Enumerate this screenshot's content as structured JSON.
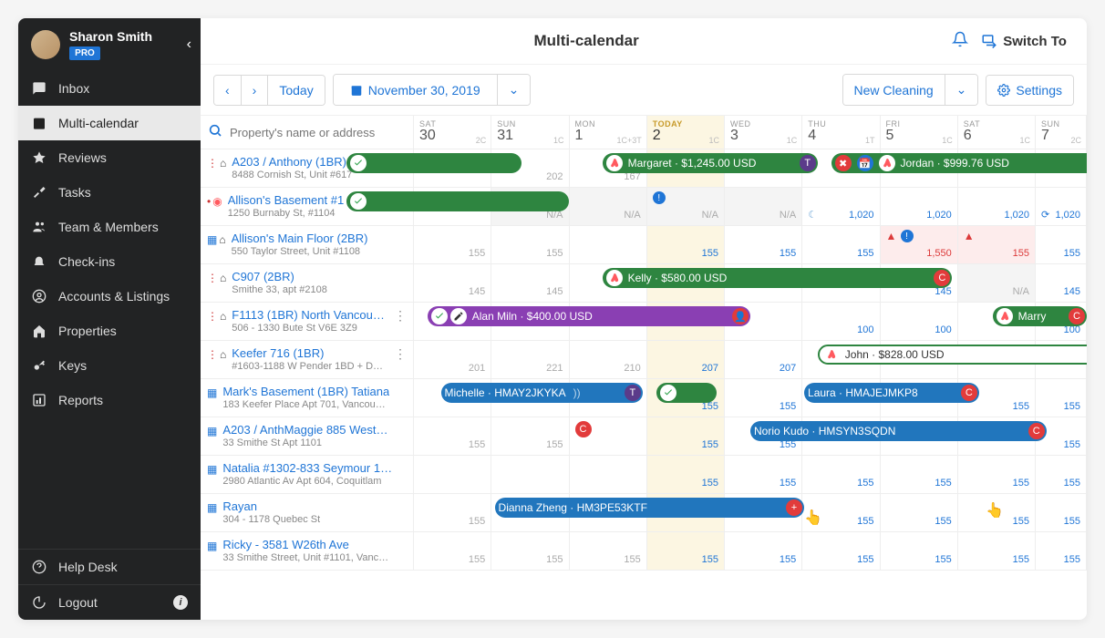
{
  "user": {
    "name": "Sharon Smith",
    "badge": "PRO"
  },
  "nav": {
    "items": [
      {
        "icon": "inbox",
        "label": "Inbox"
      },
      {
        "icon": "calendar",
        "label": "Multi-calendar",
        "active": true
      },
      {
        "icon": "star",
        "label": "Reviews"
      },
      {
        "icon": "broom",
        "label": "Tasks"
      },
      {
        "icon": "team",
        "label": "Team & Members"
      },
      {
        "icon": "bell",
        "label": "Check-ins"
      },
      {
        "icon": "account",
        "label": "Accounts & Listings"
      },
      {
        "icon": "home",
        "label": "Properties"
      },
      {
        "icon": "key",
        "label": "Keys"
      },
      {
        "icon": "chart",
        "label": "Reports"
      }
    ],
    "footer": [
      {
        "icon": "help",
        "label": "Help Desk"
      },
      {
        "icon": "logout",
        "label": "Logout",
        "info": true
      }
    ]
  },
  "header": {
    "title": "Multi-calendar",
    "switch": "Switch To"
  },
  "toolbar": {
    "today": "Today",
    "date": "November 30, 2019",
    "new_cleaning": "New Cleaning",
    "settings": "Settings"
  },
  "search": {
    "placeholder": "Property's name or address"
  },
  "days": [
    {
      "dow": "SAT",
      "num": "30",
      "cc": "2C"
    },
    {
      "dow": "SUN",
      "num": "31",
      "cc": "1C"
    },
    {
      "dow": "MON",
      "num": "1",
      "cc": "1C+3T"
    },
    {
      "dow": "TODAY",
      "num": "2",
      "cc": "1C",
      "today": true
    },
    {
      "dow": "WED",
      "num": "3",
      "cc": "1C"
    },
    {
      "dow": "THU",
      "num": "4",
      "cc": "1T"
    },
    {
      "dow": "FRI",
      "num": "5",
      "cc": "1C"
    },
    {
      "dow": "SAT",
      "num": "6",
      "cc": "1C"
    },
    {
      "dow": "SUN",
      "num": "7",
      "cc": "2C"
    }
  ],
  "properties": [
    {
      "name": "A203 / Anthony (1BR)",
      "addr": "8488 Cornish St, Unit #617",
      "icons": [
        "dots",
        "home"
      ],
      "menu": false,
      "cells": [
        "202",
        "167",
        "",
        "",
        "",
        "",
        "",
        ""
      ],
      "events": [
        {
          "text": "",
          "color": "green",
          "start": -10,
          "end": 16,
          "check": true
        },
        {
          "text": "Margaret · $1,245.00 USD",
          "color": "green",
          "air": true,
          "start": 28,
          "end": 60,
          "rbadge": "pur",
          "rchar": "T"
        },
        {
          "text": "Jordan · $999.76 USD",
          "color": "green",
          "air": true,
          "start": 62,
          "end": 105,
          "lred": true,
          "lblue": true
        }
      ]
    },
    {
      "name": "Allison's Basement #1 (1BR)",
      "addr": "1250 Burnaby St, #1104",
      "icons": [
        "dot-r",
        "air"
      ],
      "cells": [
        "",
        "N/A",
        "N/A",
        "N/A",
        "N/A",
        "1,020",
        "1,020",
        "1,020",
        "1,020"
      ],
      "cellClass": [
        "",
        "na",
        "na",
        "na",
        "na",
        "",
        "",
        "",
        ""
      ],
      "cellStyle": [
        "",
        "",
        "",
        "",
        "",
        "moon b",
        "b",
        "b",
        "refresh b"
      ],
      "events": [
        {
          "text": "",
          "color": "green",
          "start": -10,
          "end": 23,
          "check": true
        }
      ],
      "exclAt": 3
    },
    {
      "name": "Allison's Main Floor (2BR)",
      "addr": "550 Taylor Street, Unit #1108",
      "icons": [
        "blue-sq",
        "home"
      ],
      "cells": [
        "155",
        "155",
        "",
        "155",
        "155",
        "155",
        "1,550",
        "155",
        "155"
      ],
      "cellClass": [
        "",
        "",
        "",
        "",
        "",
        "",
        "pink",
        "pink",
        ""
      ],
      "cellStyle": [
        "",
        "",
        "",
        "b",
        "b",
        "b",
        "warn excl red",
        "warn red",
        "b"
      ]
    },
    {
      "name": "C907 (2BR)",
      "addr": "Smithe 33, apt #2108",
      "icons": [
        "dots",
        "home"
      ],
      "cells": [
        "145",
        "145",
        "",
        "",
        "",
        "",
        "145",
        "N/A",
        "145"
      ],
      "cellClass": [
        "",
        "",
        "",
        "",
        "",
        "",
        "",
        "na",
        ""
      ],
      "cellStyle": [
        "",
        "",
        "",
        "",
        "",
        "",
        "b",
        "",
        "b"
      ],
      "events": [
        {
          "text": "Kelly · $580.00 USD",
          "color": "green",
          "air": true,
          "start": 28,
          "end": 80,
          "rbadge": "red",
          "rchar": "C"
        }
      ]
    },
    {
      "name": "F1113 (1BR) North Vancouver",
      "addr": "506 - 1330 Bute St V6E 3Z9",
      "icons": [
        "dots",
        "home"
      ],
      "menu": true,
      "cells": [
        "",
        "",
        "",
        "",
        "",
        "100",
        "100",
        "",
        "100"
      ],
      "cellStyle": [
        "",
        "",
        "",
        "",
        "",
        "b",
        "b",
        "",
        "b"
      ],
      "events": [
        {
          "text": "Alan Miln · $400.00 USD",
          "color": "purple",
          "start": 2,
          "end": 50,
          "check": true,
          "pencil": true,
          "rbadge": "red",
          "rperson": true
        },
        {
          "text": "Marry",
          "color": "green",
          "air": true,
          "start": 86,
          "end": 100,
          "rbadge": "red",
          "rchar": "C"
        }
      ]
    },
    {
      "name": "Keefer 716 (1BR)",
      "addr": "#1603-1188 W Pender 1BD + D…",
      "icons": [
        "dots",
        "home"
      ],
      "menu": true,
      "cells": [
        "201",
        "221",
        "210",
        "207",
        "207",
        "",
        "",
        "",
        ""
      ],
      "cellStyle": [
        "",
        "",
        "",
        "b",
        "b",
        "",
        "",
        "",
        ""
      ],
      "events": [
        {
          "text": "John · $828.00 USD",
          "color": "green",
          "air": true,
          "whitebg": true,
          "start": 60,
          "end": 105
        }
      ]
    },
    {
      "name": "Mark's Basement (1BR) Tatiana",
      "addr": "183 Keefer Place Apt 701, Vancou…",
      "icons": [
        "blue-sq"
      ],
      "cells": [
        "",
        "",
        "",
        "155",
        "155",
        "",
        "",
        "155",
        "155"
      ],
      "cellStyle": [
        "",
        "",
        "",
        "b",
        "b",
        "",
        "",
        "b",
        "b"
      ],
      "events": [
        {
          "text": "Michelle · HMAY2JKYKA",
          "color": "blue",
          "start": 4,
          "end": 34,
          "rbadge": "pur",
          "rchar": "T",
          "tail": true
        },
        {
          "color": "green",
          "start": 36,
          "end": 45,
          "checkonly": true
        },
        {
          "text": "Laura · HMAJEJMKP8",
          "color": "blue",
          "start": 58,
          "end": 84,
          "rbadge": "red",
          "rchar": "C"
        }
      ]
    },
    {
      "name": "A203 / AnthMaggie 885 West…",
      "addr": "33 Smithe St Apt 1101",
      "icons": [
        "blue-sq"
      ],
      "cells": [
        "155",
        "155",
        "",
        "155",
        "155",
        "",
        "",
        "",
        "155"
      ],
      "cellStyle": [
        "",
        "",
        "",
        "b",
        "b",
        "",
        "",
        "",
        "b"
      ],
      "events": [
        {
          "text": "Norio Kudo · HMSYN3SQDN",
          "color": "blue",
          "start": 50,
          "end": 94,
          "rbadge": "red",
          "rchar": "C"
        }
      ],
      "redC": 2
    },
    {
      "name": "Natalia #1302-833 Seymour 1…",
      "addr": "2980 Atlantic Av Apt 604, Coquitlam",
      "icons": [
        "blue-sq"
      ],
      "cells": [
        "",
        "",
        "",
        "155",
        "155",
        "155",
        "155",
        "155",
        "155"
      ],
      "cellStyle": [
        "",
        "",
        "",
        "b",
        "b",
        "b",
        "b",
        "b",
        "b"
      ]
    },
    {
      "name": "Rayan",
      "addr": "304 - 1178 Quebec St",
      "icons": [
        "blue-sq"
      ],
      "cells": [
        "155",
        "",
        "",
        "",
        "",
        "155",
        "155",
        "155",
        "155"
      ],
      "cellStyle": [
        "",
        "",
        "",
        "",
        "",
        "b",
        "b",
        "b",
        "b"
      ],
      "events": [
        {
          "text": "Dianna Zheng · HM3PE53KTF",
          "color": "blue",
          "start": 12,
          "end": 58,
          "rbadge": "red",
          "rplus": true
        }
      ],
      "cursor1": 58,
      "cursor2": 85
    },
    {
      "name": "Ricky - 3581 W26th Ave",
      "addr": "33 Smithe Street, Unit #1101, Vanc…",
      "icons": [
        "blue-sq"
      ],
      "cells": [
        "155",
        "155",
        "155",
        "155",
        "155",
        "155",
        "155",
        "155",
        "155"
      ],
      "cellStyle": [
        "",
        "",
        "",
        "b",
        "b",
        "b",
        "b",
        "b",
        "b"
      ]
    }
  ],
  "colors": {
    "link": "#1f75d6",
    "green": "#2e8540",
    "purple": "#8a3fb3",
    "blue": "#2176bd",
    "red": "#e23b3b"
  }
}
